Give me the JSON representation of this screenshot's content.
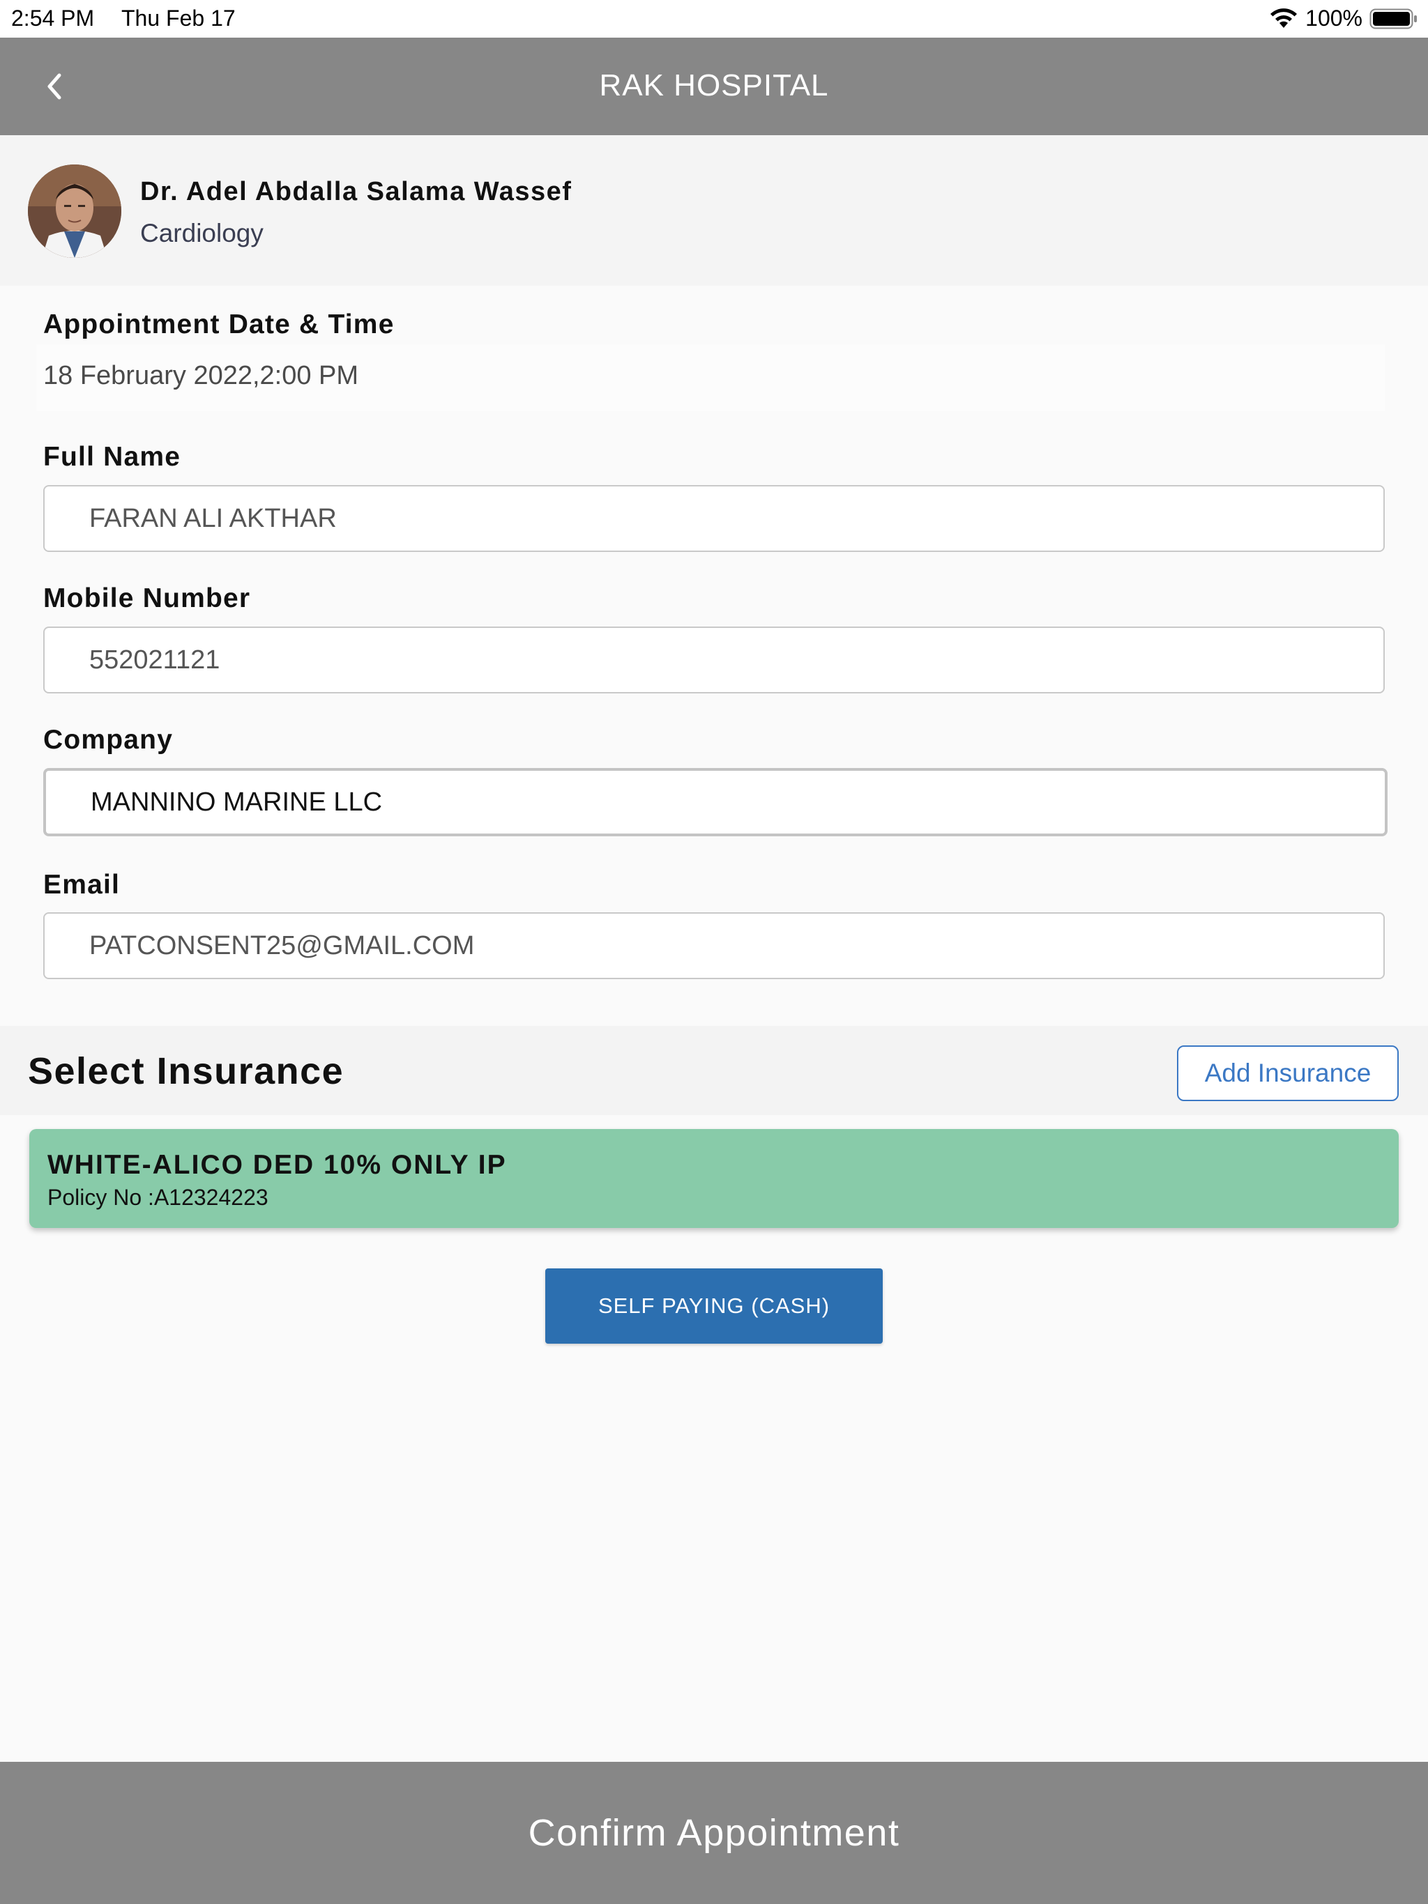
{
  "status_bar": {
    "time": "2:54 PM",
    "date": "Thu Feb 17",
    "battery": "100%"
  },
  "nav": {
    "title": "RAK HOSPITAL",
    "back_icon": "chevron-left-icon"
  },
  "doctor": {
    "name": "Dr. Adel Abdalla Salama Wassef",
    "specialty": "Cardiology"
  },
  "form": {
    "appointment_label": "Appointment Date & Time",
    "appointment_value": "18 February 2022,2:00 PM",
    "full_name_label": "Full Name",
    "full_name_value": "FARAN ALI AKTHAR",
    "mobile_label": "Mobile Number",
    "mobile_value": "552021121",
    "company_label": "Company",
    "company_value": "MANNINO MARINE LLC",
    "email_label": "Email",
    "email_value": "PATCONSENT25@GMAIL.COM"
  },
  "insurance": {
    "section_title": "Select Insurance",
    "add_button_label": "Add Insurance",
    "selected_card": {
      "name": "WHITE-ALICO DED 10% ONLY IP",
      "policy_label": "Policy No :",
      "policy_number": "A12324223"
    },
    "self_pay_label": "SELF PAYING (CASH)"
  },
  "footer": {
    "confirm_label": "Confirm Appointment"
  },
  "colors": {
    "header_gray": "#878787",
    "accent_blue": "#3b78c4",
    "self_pay_blue": "#2c6fb0",
    "insurance_green": "#88cba9"
  }
}
